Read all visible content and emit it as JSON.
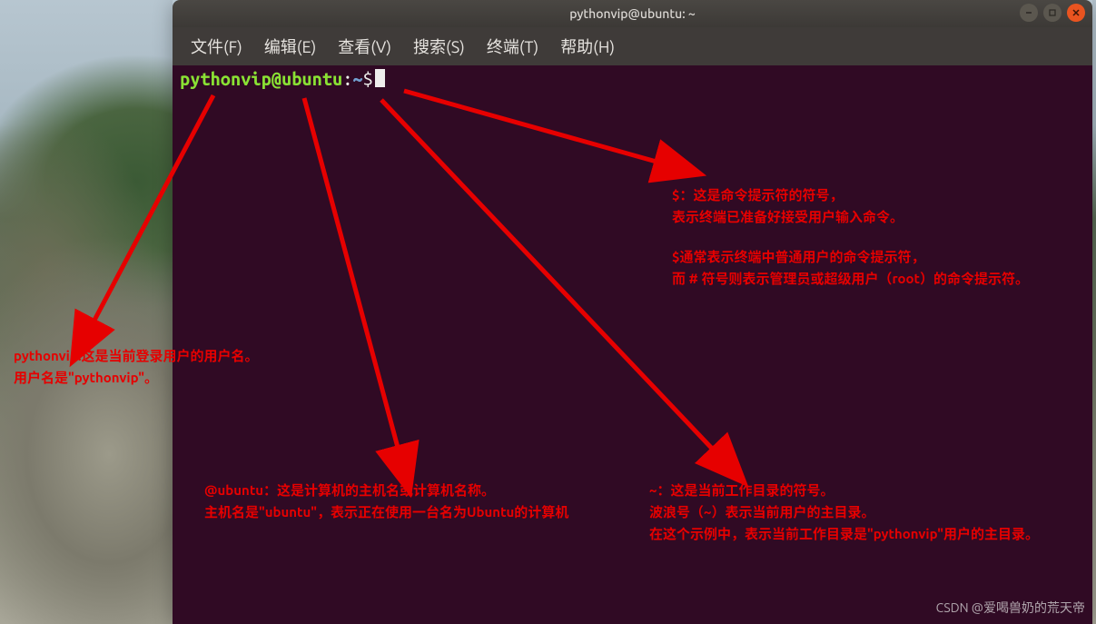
{
  "window": {
    "title": "pythonvip@ubuntu: ~"
  },
  "menubar": {
    "file": "文件(F)",
    "edit": "编辑(E)",
    "view": "查看(V)",
    "search": "搜索(S)",
    "terminal": "终端(T)",
    "help": "帮助(H)"
  },
  "prompt": {
    "userhost": "pythonvip@ubuntu",
    "colon": ":",
    "path": "~",
    "dollar": "$"
  },
  "annotations": {
    "user_l1": "pythonvip:这是当前登录用户的用户名。",
    "user_l2": "用户名是\"pythonvip\"。",
    "host_l1": "@ubuntu：这是计算机的主机名或计算机名称。",
    "host_l2": "主机名是\"ubuntu\"，表示正在使用一台名为Ubuntu的计算机",
    "tilde_l1": "~：这是当前工作目录的符号。",
    "tilde_l2": "波浪号（~）表示当前用户的主目录。",
    "tilde_l3": "在这个示例中，表示当前工作目录是\"pythonvip\"用户的主目录。",
    "dollar_l1": "$：这是命令提示符的符号，",
    "dollar_l2": "表示终端已准备好接受用户输入命令。",
    "dollar_l3": "$通常表示终端中普通用户的命令提示符，",
    "dollar_l4": "而 # 符号则表示管理员或超级用户（root）的命令提示符。"
  },
  "watermark": "CSDN @爱喝兽奶的荒天帝",
  "colors": {
    "terminal_bg": "#300a24",
    "prompt_user": "#8ae234",
    "prompt_path": "#729fcf",
    "annotation": "#e60000",
    "close_btn": "#e95420"
  }
}
